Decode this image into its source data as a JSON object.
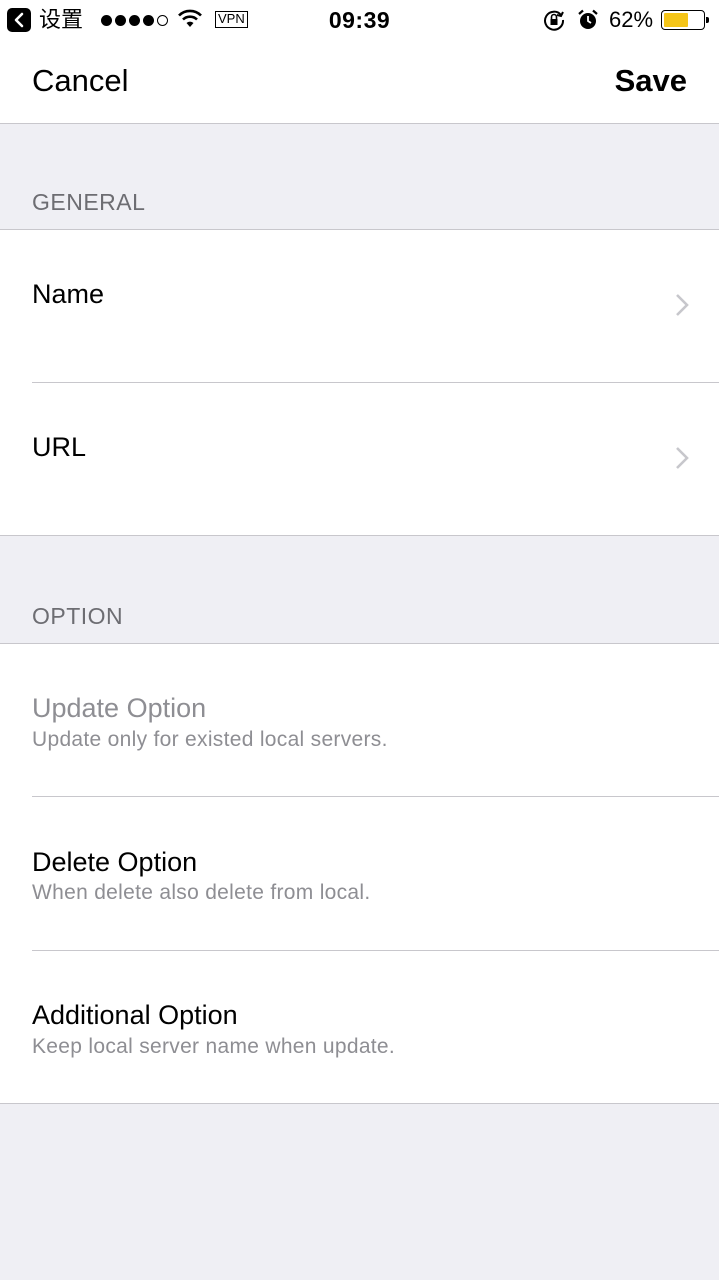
{
  "status_bar": {
    "back_app": "设置",
    "signal_filled": 4,
    "signal_total": 5,
    "vpn": "VPN",
    "time": "09:39",
    "battery_percent": "62%",
    "battery_level": 0.62,
    "battery_color": "#f5c518",
    "icons": [
      "back-arrow-icon",
      "wifi-icon",
      "rotation-lock-icon",
      "alarm-icon",
      "battery-icon"
    ]
  },
  "nav": {
    "cancel_label": "Cancel",
    "save_label": "Save"
  },
  "general": {
    "header": "GENERAL",
    "rows": [
      {
        "title": "Name"
      },
      {
        "title": "URL"
      }
    ]
  },
  "option": {
    "header": "OPTION",
    "rows": [
      {
        "title": "Update Option",
        "subtitle": "Update only for existed local servers.",
        "disabled": true
      },
      {
        "title": "Delete Option",
        "subtitle": "When delete also delete from local.",
        "disabled": false
      },
      {
        "title": "Additional Option",
        "subtitle": "Keep local server name when update.",
        "disabled": false
      }
    ]
  },
  "colors": {
    "background": "#efeff4",
    "separator": "#c8c7cc",
    "header_text": "#6d6d72",
    "secondary_text": "#8e8e93",
    "chevron": "#c7c7cc"
  }
}
